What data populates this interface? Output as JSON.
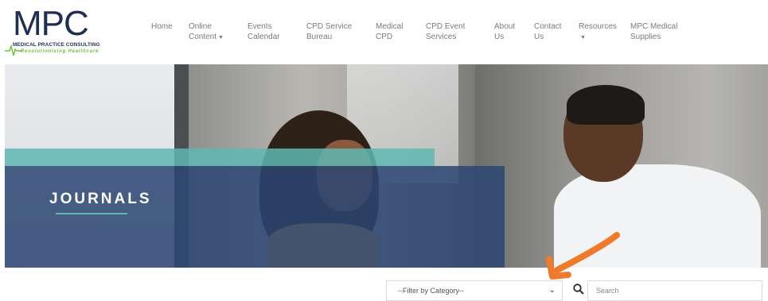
{
  "logo": {
    "letters": "MPC",
    "subtitle": "MEDICAL PRACTICE CONSULTING",
    "tagline": "Revolutionising Healthcare"
  },
  "nav": {
    "items": [
      {
        "line1": "Home",
        "line2": ""
      },
      {
        "line1": "Online",
        "line2": "Content",
        "dropdown": true
      },
      {
        "line1": "Events",
        "line2": "Calendar"
      },
      {
        "line1": "CPD Service",
        "line2": "Bureau"
      },
      {
        "line1": "Medical",
        "line2": "CPD"
      },
      {
        "line1": "CPD Event",
        "line2": "Services"
      },
      {
        "line1": "About",
        "line2": "Us"
      },
      {
        "line1": "Contact",
        "line2": "Us"
      },
      {
        "line1": "Resources",
        "line2": "",
        "dropdown": true
      },
      {
        "line1": "MPC Medical",
        "line2": "Supplies"
      }
    ]
  },
  "hero": {
    "title": "JOURNALS"
  },
  "filter": {
    "selected": "--Filter by Category--"
  },
  "search": {
    "placeholder": "Search"
  },
  "colors": {
    "navy": "#2c4673",
    "teal": "#5fb7b2",
    "logo_green": "#6bbf3a",
    "annotation_arrow": "#f07a2a"
  },
  "icons": {
    "search": "search-icon",
    "dropdown": "chevron-down-icon",
    "annotation": "arrow-annotation-icon"
  }
}
